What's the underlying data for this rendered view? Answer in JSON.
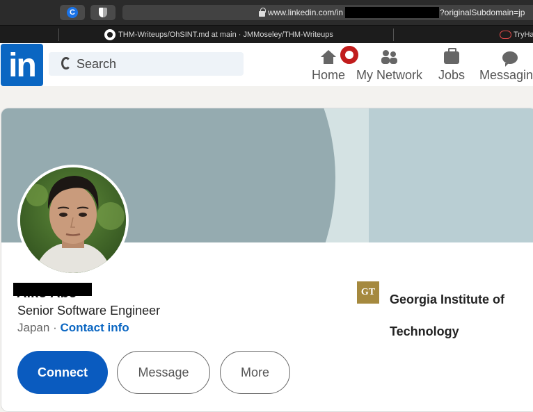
{
  "browser": {
    "url_prefix": "www.linkedin.com/in",
    "url_suffix": "?originalSubdomain=jp",
    "tabs": [
      {
        "label": "THM-Writeups/OhSINT.md at main · JMMoseley/THM-Writeups"
      },
      {
        "label": "TryHa"
      }
    ]
  },
  "nav": {
    "logo": "in",
    "search_placeholder": "Search",
    "items": [
      {
        "label": "Home",
        "icon": "home-icon"
      },
      {
        "label": "My Network",
        "icon": "network-icon"
      },
      {
        "label": "Jobs",
        "icon": "briefcase-icon"
      },
      {
        "label": "Messaging",
        "icon": "message-icon"
      }
    ]
  },
  "profile": {
    "name": "Aiko Abe",
    "headline": "Senior Software Engineer",
    "location": "Japan",
    "separator": "·",
    "contact_info": "Contact info",
    "buttons": {
      "connect": "Connect",
      "message": "Message",
      "more": "More"
    },
    "education": {
      "logo_text": "GT",
      "school": "Georgia Institute of Technology"
    }
  },
  "colors": {
    "brand": "#0a66c2",
    "connect_button": "#0a5bbf",
    "notification": "#c11c1c",
    "banner_dark": "#95abb0",
    "banner_light": "#b9ced3"
  }
}
